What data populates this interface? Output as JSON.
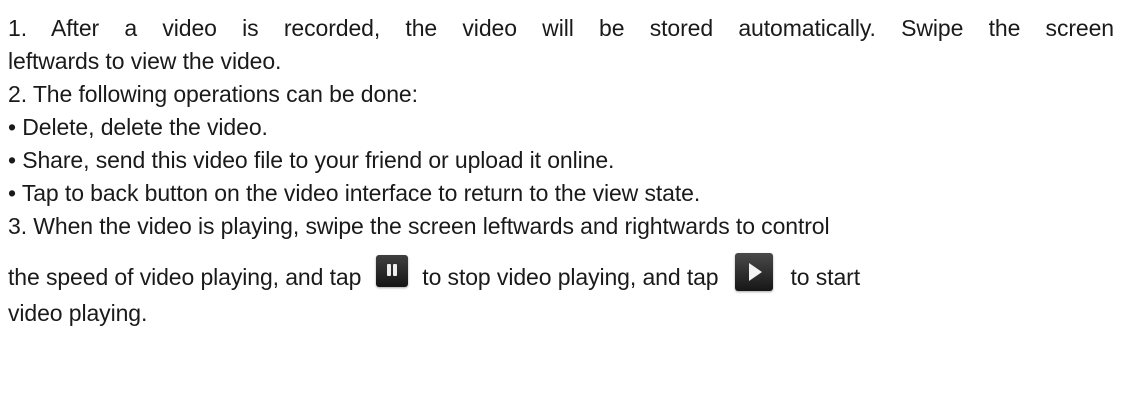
{
  "paragraphs": {
    "p1_line1": "1. After a video is recorded, the video will be stored automatically. Swipe the screen",
    "p1_line2": "leftwards to view the video.",
    "p2": "2. The following operations can be done:",
    "bullet1": "• Delete, delete the video.",
    "bullet2": "• Share, send this video file to your friend or upload it online.",
    "bullet3": "• Tap to back button on the video interface to return to the view state.",
    "p3_line1": "3. When the video is playing, swipe the screen leftwards and rightwards to control",
    "p3_line2_part1": "the speed of video playing, and tap",
    "p3_line2_part2": "to stop video playing, and tap",
    "p3_line2_part3": "to start",
    "p3_line3": "video playing."
  },
  "icons": {
    "pause": "pause-icon",
    "play": "play-icon"
  }
}
